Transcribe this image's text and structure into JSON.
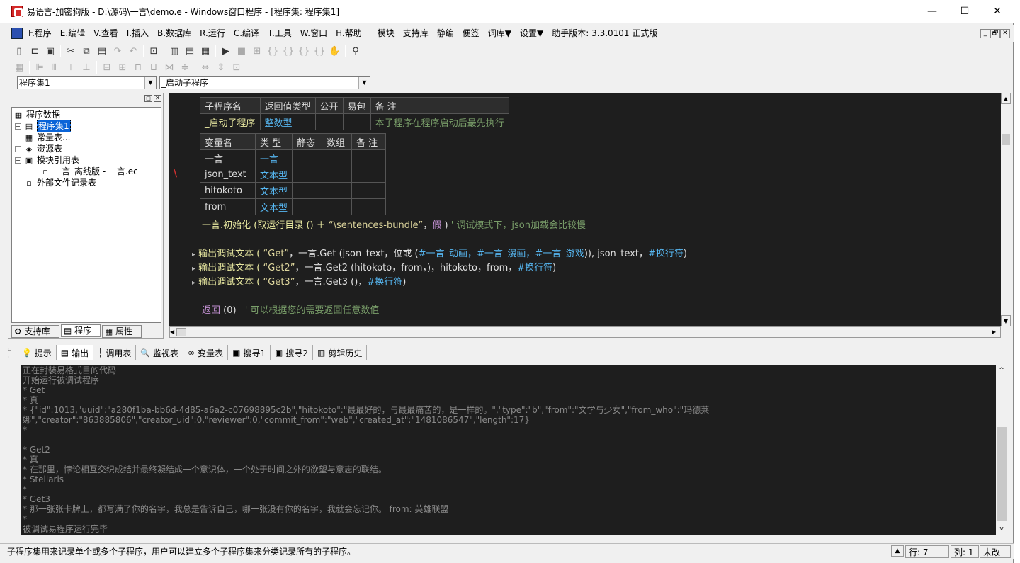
{
  "window": {
    "title": "易语言-加密狗版 - D:\\源码\\一言\\demo.e - Windows窗口程序 - [程序集: 程序集1]",
    "min_glyph": "—",
    "max_glyph": "☐",
    "close_glyph": "✕"
  },
  "menu": {
    "items": [
      "F.程序",
      "E.编辑",
      "V.查看",
      "I.插入",
      "B.数据库",
      "R.运行",
      "C.编译",
      "T.工具",
      "W.窗口",
      "H.帮助",
      "模块",
      "支持库",
      "静编",
      "便签",
      "词库▼",
      "设置▼",
      "助手版本: 3.3.0101 正式版"
    ],
    "mdi": [
      "_",
      "🗗",
      "✕"
    ]
  },
  "selectors": {
    "assembly": "程序集1",
    "subprogram": "_启动子程序"
  },
  "tree": {
    "root": "程序数据",
    "items": [
      {
        "label": "程序集1",
        "icon": "assembly-icon",
        "glyph": "▤",
        "selected": true,
        "expander": "+"
      },
      {
        "label": "常量表...",
        "icon": "constant-table-icon",
        "glyph": "▦",
        "expander": ""
      },
      {
        "label": "资源表",
        "icon": "resource-table-icon",
        "glyph": "◈",
        "expander": "+"
      },
      {
        "label": "模块引用表",
        "icon": "module-reference-icon",
        "glyph": "▣",
        "expander": "−"
      },
      {
        "label": "一言_离线版 - 一言.ec",
        "icon": "module-file-icon",
        "glyph": "▫",
        "expander": ""
      },
      {
        "label": "外部文件记录表",
        "icon": "external-file-icon",
        "glyph": "▫",
        "expander": ""
      }
    ],
    "tabs": [
      "支持库",
      "程序",
      "属性"
    ]
  },
  "sub_table": {
    "headers": [
      "子程序名",
      "返回值类型",
      "公开",
      "易包",
      "备 注"
    ],
    "row": {
      "name": "_启动子程序",
      "return_type": "整数型",
      "public": "",
      "pkg": "",
      "remark": "本子程序在程序启动后最先执行"
    }
  },
  "var_table": {
    "headers": [
      "变量名",
      "类 型",
      "静态",
      "数组",
      "备 注"
    ],
    "rows": [
      {
        "name": "一言",
        "type": "一言"
      },
      {
        "name": "json_text",
        "type": "文本型"
      },
      {
        "name": "hitokoto",
        "type": "文本型"
      },
      {
        "name": "from",
        "type": "文本型"
      }
    ]
  },
  "code": {
    "line1_call": "一言.初始化 (取运行目录 () ＋",
    "line1_str": "“\\sentences-bundle”",
    "line1_sep": "，",
    "line1_const": "假",
    "line1_close": ")",
    "line1_comment": "' 调试模式下，json加载会比较慢",
    "line2_fn": "输出调试文本 (",
    "line2_str": "“Get”",
    "line2_rest": "，一言.Get (json_text，位或 (",
    "line2_consts": "#一言_动画，#一言_漫画，#一言_游戏",
    "line2_tail": ")), json_text，",
    "line2_end": "#换行符",
    "line2_close": ")",
    "line3_fn": "输出调试文本 (",
    "line3_str": "“Get2”",
    "line3_rest": "，一言.Get2 (hitokoto，from，)，hitokoto，from，",
    "line3_end": "#换行符",
    "line3_close": ")",
    "line4_fn": "输出调试文本 (",
    "line4_str": "“Get3”",
    "line4_rest": "，一言.Get3 ()，",
    "line4_end": "#换行符",
    "line4_close": ")",
    "ret_kw": "返回",
    "ret_val": "(0)",
    "ret_comment": "' 可以根据您的需要返回任意数值",
    "arrow": "▸",
    "breakpoint": "\\"
  },
  "output_tabs": [
    {
      "label": "提示",
      "icon": "hint-icon",
      "glyph": "💡"
    },
    {
      "label": "输出",
      "icon": "output-icon",
      "glyph": "▤"
    },
    {
      "label": "调用表",
      "icon": "call-table-icon",
      "glyph": "┆"
    },
    {
      "label": "监视表",
      "icon": "watch-icon",
      "glyph": "🔍"
    },
    {
      "label": "变量表",
      "icon": "variable-icon",
      "glyph": "∞"
    },
    {
      "label": "搜寻1",
      "icon": "search1-icon",
      "glyph": "▣"
    },
    {
      "label": "搜寻2",
      "icon": "search2-icon",
      "glyph": "▣"
    },
    {
      "label": "剪辑历史",
      "icon": "clip-history-icon",
      "glyph": "▥"
    }
  ],
  "output_lines": [
    "正在封装易格式目的代码",
    "开始运行被调试程序",
    "* Get",
    "* 真",
    "* {\"id\":1013,\"uuid\":\"a280f1ba-bb6d-4d85-a6a2-c07698895c2b\",\"hitokoto\":\"最最好的，与最最痛苦的，是一样的。\",\"type\":\"b\",\"from\":\"文学与少女\",\"from_who\":\"玛德莱",
    "娜\",\"creator\":\"863885806\",\"creator_uid\":0,\"reviewer\":0,\"commit_from\":\"web\",\"created_at\":\"1481086547\",\"length\":17}",
    "*",
    "",
    "* Get2",
    "* 真",
    "* 在那里，悖论相互交织成结并最终凝结成一个意识体，一个处于时间之外的欲望与意志的联结。",
    "* Stellaris",
    "*",
    "* Get3",
    "* 那一张张卡牌上，都写满了你的名字，我总是告诉自己，哪一张没有你的名字，我就会忘记你。     from: 英雄联盟",
    "*",
    "被调试易程序运行完毕"
  ],
  "status": {
    "message": "子程序集用来记录单个或多个子程序，用户可以建立多个子程序集来分类记录所有的子程序。",
    "row": "行: 7",
    "col": "列: 1",
    "mode": "末改"
  }
}
